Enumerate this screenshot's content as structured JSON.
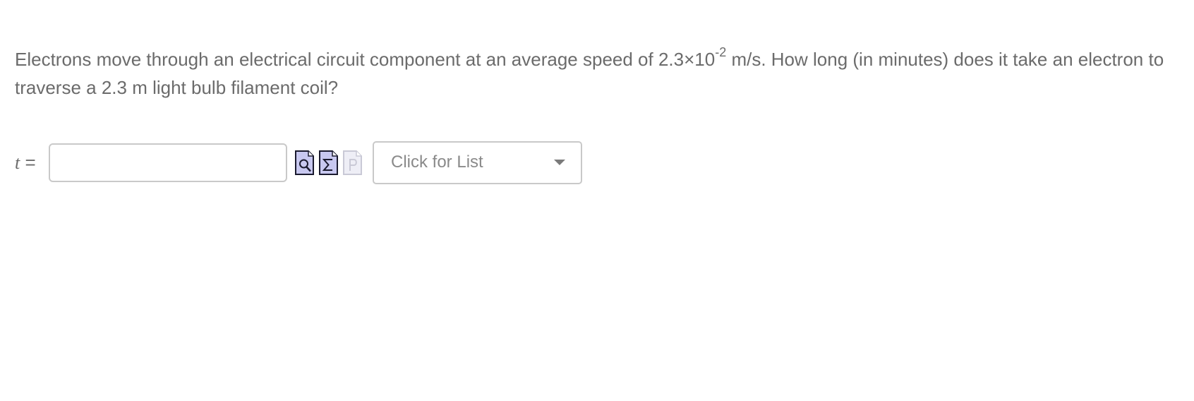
{
  "question": {
    "text_before_exp": "Electrons move through an electrical circuit component at an average speed of 2.3×10",
    "exponent": "-2",
    "text_after_exp": " m/s. How long (in minutes) does it take an electron to traverse a 2.3 m light bulb filament coil?"
  },
  "answer": {
    "variable": "t",
    "equals": " =",
    "value": "",
    "placeholder": ""
  },
  "tools": {
    "icons": [
      "preview-icon",
      "sigma-formula-icon",
      "p-icon-disabled"
    ],
    "accent": "#c8c8f0"
  },
  "units_dropdown": {
    "label": "Click for List"
  }
}
